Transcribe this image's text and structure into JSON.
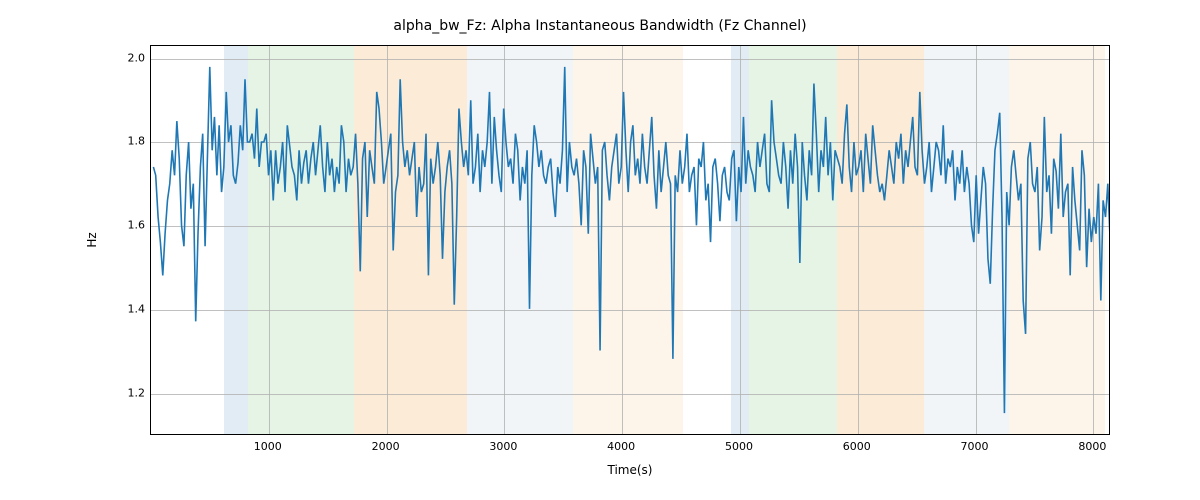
{
  "chart_data": {
    "type": "line",
    "title": "alpha_bw_Fz: Alpha Instantaneous Bandwidth (Fz Channel)",
    "xlabel": "Time(s)",
    "ylabel": "Hz",
    "xlim": [
      0,
      8150
    ],
    "ylim": [
      1.1,
      2.03
    ],
    "xticks": [
      1000,
      2000,
      3000,
      4000,
      5000,
      6000,
      7000,
      8000
    ],
    "yticks": [
      1.2,
      1.4,
      1.6,
      1.8,
      2.0
    ],
    "bands": [
      {
        "x0": 620,
        "x1": 820,
        "color": "#a8c8e0"
      },
      {
        "x0": 820,
        "x1": 1720,
        "color": "#b8e0b8"
      },
      {
        "x0": 1720,
        "x1": 2680,
        "color": "#f6c88c"
      },
      {
        "x0": 2680,
        "x1": 3580,
        "color": "#d6e2ec"
      },
      {
        "x0": 3580,
        "x1": 4520,
        "color": "#f9e0c2"
      },
      {
        "x0": 4920,
        "x1": 5080,
        "color": "#a8c8e0"
      },
      {
        "x0": 5080,
        "x1": 5820,
        "color": "#b8e0b8"
      },
      {
        "x0": 5820,
        "x1": 6560,
        "color": "#f6c88c"
      },
      {
        "x0": 6560,
        "x1": 7280,
        "color": "#d6e2ec"
      },
      {
        "x0": 7280,
        "x1": 8100,
        "color": "#f9e0c2"
      }
    ],
    "series": [
      {
        "name": "alpha_bw_Fz",
        "x_start": 20,
        "x_step": 20,
        "y": [
          1.74,
          1.72,
          1.62,
          1.56,
          1.48,
          1.58,
          1.66,
          1.7,
          1.78,
          1.72,
          1.85,
          1.76,
          1.6,
          1.55,
          1.72,
          1.8,
          1.64,
          1.7,
          1.37,
          1.58,
          1.74,
          1.82,
          1.55,
          1.76,
          1.98,
          1.78,
          1.86,
          1.72,
          1.84,
          1.68,
          1.74,
          1.92,
          1.8,
          1.84,
          1.72,
          1.7,
          1.75,
          1.84,
          1.78,
          1.95,
          1.8,
          1.8,
          1.82,
          1.76,
          1.88,
          1.74,
          1.8,
          1.8,
          1.82,
          1.72,
          1.78,
          1.66,
          1.78,
          1.7,
          1.74,
          1.8,
          1.68,
          1.84,
          1.79,
          1.74,
          1.72,
          1.66,
          1.78,
          1.7,
          1.75,
          1.78,
          1.7,
          1.76,
          1.8,
          1.72,
          1.78,
          1.84,
          1.74,
          1.68,
          1.8,
          1.72,
          1.76,
          1.68,
          1.74,
          1.7,
          1.84,
          1.8,
          1.68,
          1.76,
          1.72,
          1.74,
          1.82,
          1.7,
          1.49,
          1.76,
          1.8,
          1.62,
          1.78,
          1.74,
          1.7,
          1.92,
          1.88,
          1.8,
          1.7,
          1.74,
          1.78,
          1.82,
          1.54,
          1.68,
          1.72,
          1.95,
          1.8,
          1.74,
          1.78,
          1.72,
          1.76,
          1.8,
          1.62,
          1.74,
          1.68,
          1.7,
          1.82,
          1.48,
          1.76,
          1.7,
          1.74,
          1.8,
          1.72,
          1.52,
          1.68,
          1.74,
          1.78,
          1.7,
          1.41,
          1.62,
          1.88,
          1.8,
          1.74,
          1.78,
          1.72,
          1.9,
          1.7,
          1.74,
          1.82,
          1.68,
          1.78,
          1.74,
          1.8,
          1.92,
          1.7,
          1.86,
          1.78,
          1.72,
          1.68,
          1.88,
          1.8,
          1.74,
          1.76,
          1.7,
          1.82,
          1.78,
          1.66,
          1.74,
          1.7,
          1.78,
          1.4,
          1.72,
          1.84,
          1.8,
          1.74,
          1.78,
          1.72,
          1.7,
          1.74,
          1.76,
          1.68,
          1.62,
          1.74,
          1.7,
          1.78,
          1.98,
          1.68,
          1.8,
          1.74,
          1.72,
          1.76,
          1.7,
          1.6,
          1.78,
          1.74,
          1.58,
          1.82,
          1.76,
          1.7,
          1.74,
          1.3,
          1.78,
          1.8,
          1.72,
          1.66,
          1.74,
          1.78,
          1.82,
          1.7,
          1.74,
          1.92,
          1.78,
          1.68,
          1.8,
          1.84,
          1.72,
          1.76,
          1.7,
          1.82,
          1.74,
          1.7,
          1.78,
          1.86,
          1.72,
          1.64,
          1.78,
          1.68,
          1.74,
          1.8,
          1.72,
          1.7,
          1.28,
          1.72,
          1.68,
          1.78,
          1.7,
          1.74,
          1.82,
          1.68,
          1.72,
          1.74,
          1.6,
          1.76,
          1.74,
          1.8,
          1.66,
          1.7,
          1.56,
          1.74,
          1.76,
          1.7,
          1.61,
          1.72,
          1.74,
          1.68,
          1.66,
          1.76,
          1.78,
          1.61,
          1.74,
          1.68,
          1.86,
          1.7,
          1.78,
          1.74,
          1.72,
          1.68,
          1.8,
          1.74,
          1.78,
          1.82,
          1.7,
          1.68,
          1.9,
          1.8,
          1.76,
          1.72,
          1.7,
          1.8,
          1.74,
          1.64,
          1.78,
          1.7,
          1.82,
          1.74,
          1.51,
          1.8,
          1.72,
          1.66,
          1.78,
          1.72,
          1.94,
          1.82,
          1.68,
          1.78,
          1.74,
          1.86,
          1.72,
          1.8,
          1.66,
          1.78,
          1.76,
          1.74,
          1.7,
          1.82,
          1.89,
          1.74,
          1.68,
          1.8,
          1.72,
          1.74,
          1.78,
          1.68,
          1.82,
          1.76,
          1.7,
          1.84,
          1.78,
          1.72,
          1.68,
          1.7,
          1.66,
          1.72,
          1.78,
          1.74,
          1.7,
          1.8,
          1.76,
          1.82,
          1.7,
          1.78,
          1.74,
          1.8,
          1.86,
          1.74,
          1.72,
          1.92,
          1.78,
          1.7,
          1.74,
          1.8,
          1.68,
          1.74,
          1.8,
          1.78,
          1.72,
          1.84,
          1.7,
          1.76,
          1.74,
          1.78,
          1.66,
          1.74,
          1.7,
          1.78,
          1.68,
          1.74,
          1.7,
          1.6,
          1.56,
          1.72,
          1.58,
          1.66,
          1.74,
          1.7,
          1.52,
          1.46,
          1.64,
          1.78,
          1.82,
          1.87,
          1.62,
          1.15,
          1.68,
          1.6,
          1.74,
          1.78,
          1.72,
          1.66,
          1.7,
          1.42,
          1.34,
          1.76,
          1.8,
          1.7,
          1.68,
          1.74,
          1.54,
          1.62,
          1.86,
          1.68,
          1.72,
          1.58,
          1.76,
          1.73,
          1.64,
          1.82,
          1.62,
          1.68,
          1.7,
          1.48,
          1.74,
          1.66,
          1.6,
          1.54,
          1.78,
          1.72,
          1.5,
          1.64,
          1.56,
          1.62,
          1.58,
          1.7,
          1.42,
          1.66,
          1.62,
          1.7,
          1.56,
          1.64,
          1.58
        ]
      }
    ]
  }
}
